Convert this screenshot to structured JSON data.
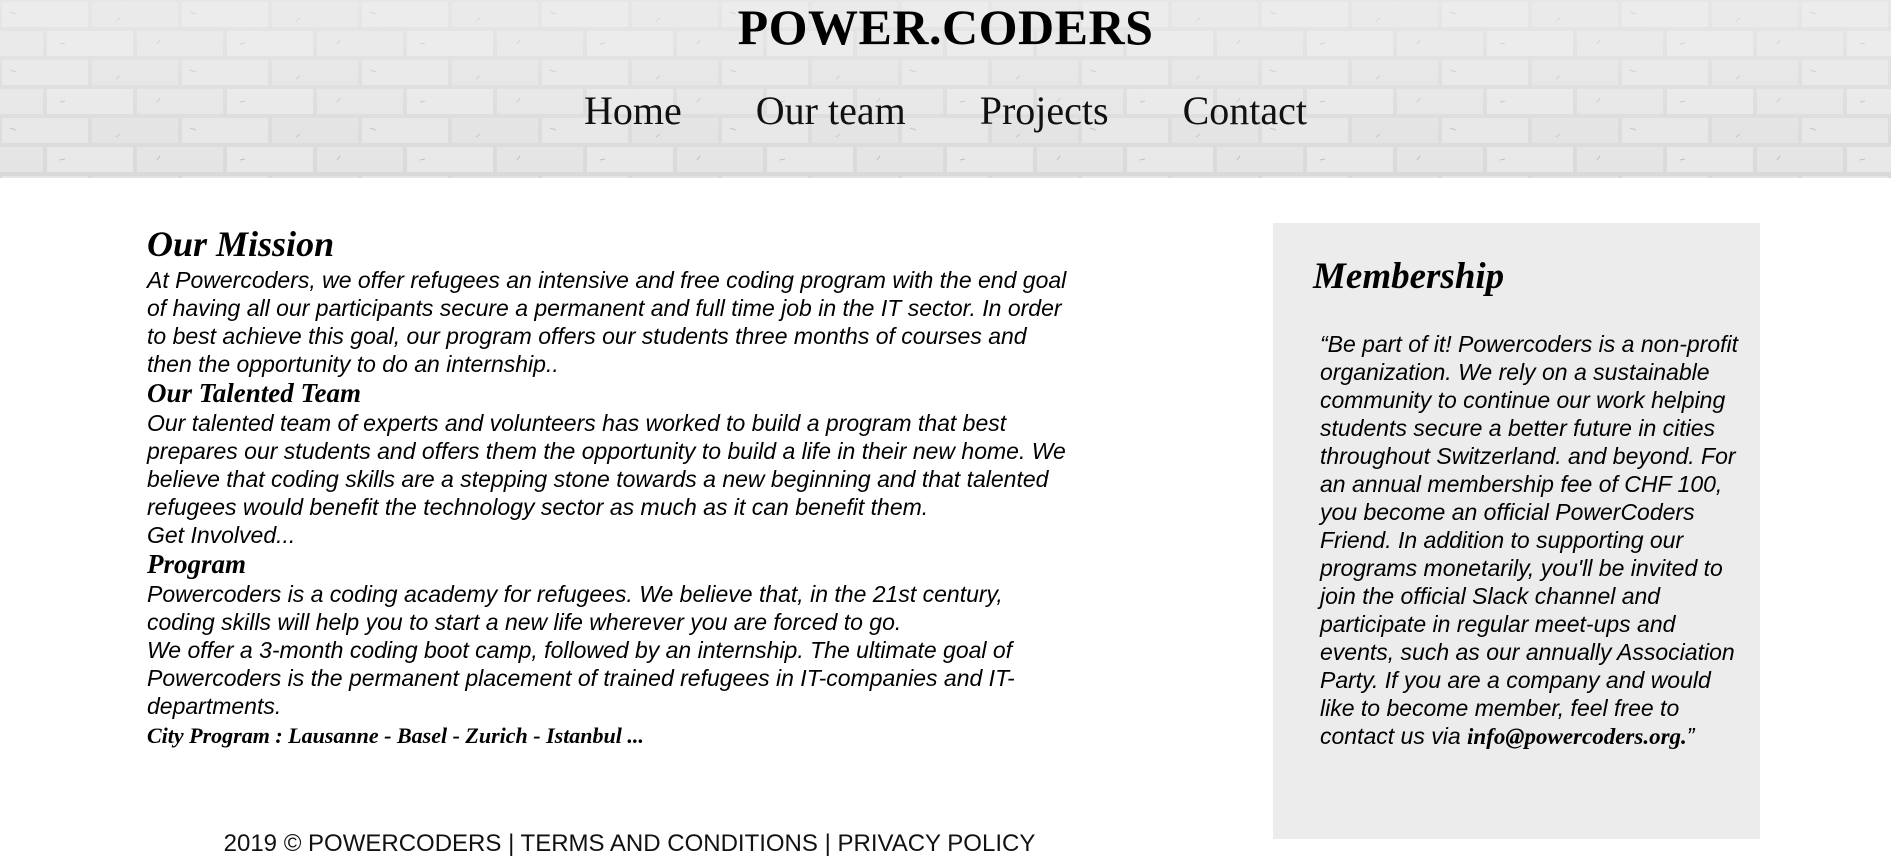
{
  "header": {
    "title": "POWER.CODERS",
    "nav": [
      "Home",
      "Our team",
      "Projects",
      "Contact"
    ]
  },
  "main": {
    "mission_heading": "Our Mission",
    "mission_text": "At Powercoders, we offer refugees an intensive and free coding program with the end goal of having all our participants secure a permanent and full time job in the IT sector. In order to best achieve this goal, our program offers our students three months of courses and then the opportunity to do an internship..",
    "team_heading": "Our Talented Team",
    "team_text": "Our talented team of experts and volunteers has worked to build a program that best prepares our students and offers them the opportunity to build a life in their new home. We believe that coding skills are a stepping stone towards a new beginning and that talented refugees would benefit the technology sector as much as it can benefit them.",
    "team_cta": "Get Involved...",
    "program_heading": "Program",
    "program_text_1": "Powercoders is a coding academy for refugees. We believe that, in the 21st century, coding skills will help you to start a new life wherever you are forced to go.",
    "program_text_2": "We offer a 3-month coding boot camp, followed by an internship. The ultimate goal of Powercoders is the permanent placement of trained refugees in IT-companies and IT-departments.",
    "city_program": "City Program : Lausanne - Basel - Zurich - Istanbul ..."
  },
  "sidebar": {
    "heading": "Membership",
    "quote": "“Be part of it! Powercoders is a non-profit organization. We rely on a sustainable community to continue our work helping students secure a better future in cities throughout Switzerland. and beyond. For an annual membership fee of CHF 100, you become an official PowerCoders Friend. In addition to supporting our programs monetarily, you'll be invited to join the official Slack channel and participate in regular meet-ups and events, such as our annually Association Party. If you are a company and would like to become member, feel free to contact us via ",
    "email": "info@powercoders.org.",
    "quote_end": "”"
  },
  "footer": {
    "copyright": "2019 © POWERCODERS",
    "separator": " | ",
    "terms": "TERMS AND CONDITIONS",
    "privacy": "PRIVACY POLICY"
  },
  "colors": {
    "sidebar_bg": "#ececec",
    "header_bg": "#dcdcdc"
  }
}
